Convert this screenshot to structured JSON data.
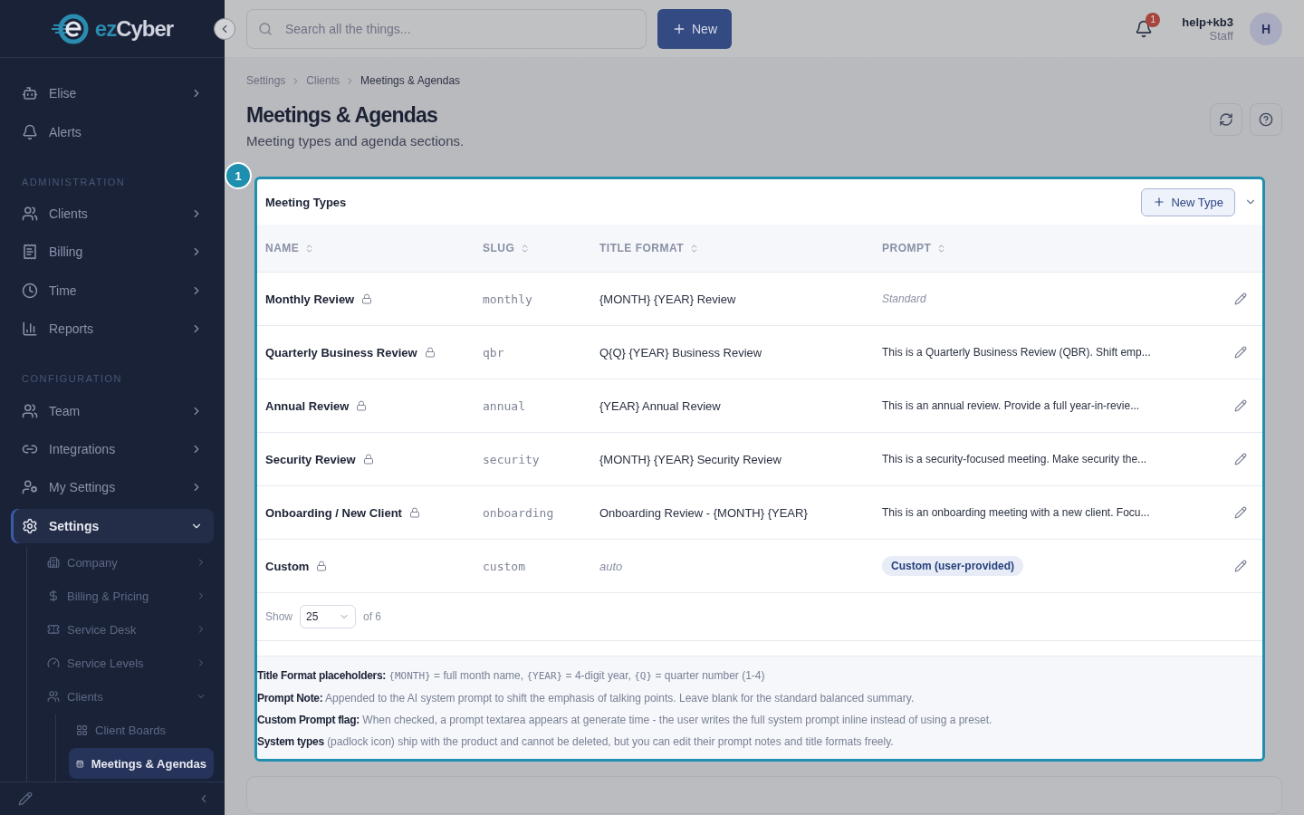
{
  "sidebar": {
    "logo": {
      "accent": "ez",
      "text": "Cyber"
    },
    "groups": [
      {
        "items": [
          {
            "label": "Elise",
            "has_chevron": true,
            "selected": false
          },
          {
            "label": "Alerts",
            "has_chevron": false,
            "selected": false
          }
        ]
      },
      {
        "heading": "ADMINISTRATION",
        "items": [
          {
            "label": "Clients",
            "has_chevron": true,
            "selected": false
          },
          {
            "label": "Billing",
            "has_chevron": true,
            "selected": false
          },
          {
            "label": "Time",
            "has_chevron": true,
            "selected": false
          },
          {
            "label": "Reports",
            "has_chevron": true,
            "selected": false
          }
        ]
      },
      {
        "heading": "CONFIGURATION",
        "items": [
          {
            "label": "Team",
            "has_chevron": true,
            "selected": false
          },
          {
            "label": "Integrations",
            "has_chevron": true,
            "selected": false
          },
          {
            "label": "My Settings",
            "has_chevron": true,
            "selected": false
          },
          {
            "label": "Settings",
            "has_chevron": true,
            "expanded": true,
            "selected": true,
            "children": [
              {
                "label": "Company",
                "selected": false
              },
              {
                "label": "Billing & Pricing",
                "selected": false
              },
              {
                "label": "Service Desk",
                "selected": false
              },
              {
                "label": "Service Levels",
                "selected": false
              },
              {
                "label": "Clients",
                "expanded": true,
                "selected": false,
                "children": [
                  {
                    "label": "Client Boards",
                    "selected": false
                  },
                  {
                    "label": "Meetings & Agendas",
                    "selected": true
                  }
                ]
              }
            ]
          }
        ]
      }
    ]
  },
  "topbar": {
    "search": {
      "placeholder": "Search all the things..."
    },
    "new_button": "New",
    "notifications": "1",
    "user": {
      "name": "help+kb3",
      "role": "Staff",
      "initial": "H"
    }
  },
  "breadcrumbs": [
    "Settings",
    "Clients",
    "Meetings & Agendas"
  ],
  "page": {
    "title": "Meetings & Agendas",
    "subtitle": "Meeting types and agenda sections."
  },
  "tour": {
    "step": "1"
  },
  "meeting_types": {
    "title": "Meeting Types",
    "new_button": "New Type",
    "columns": [
      "NAME",
      "SLUG",
      "TITLE FORMAT",
      "PROMPT"
    ],
    "rows": [
      {
        "name": "Monthly Review",
        "system": true,
        "slug": "monthly",
        "title_format": {
          "kind": "text",
          "text": "{MONTH} {YEAR} Review"
        },
        "prompt": {
          "kind": "default",
          "text": "Standard"
        }
      },
      {
        "name": "Quarterly Business Review",
        "system": true,
        "slug": "qbr",
        "title_format": {
          "kind": "text",
          "text": "Q{Q} {YEAR} Business Review"
        },
        "prompt": {
          "kind": "text",
          "text": "This is a Quarterly Business Review (QBR). Shift emp..."
        }
      },
      {
        "name": "Annual Review",
        "system": true,
        "slug": "annual",
        "title_format": {
          "kind": "text",
          "text": "{YEAR} Annual Review"
        },
        "prompt": {
          "kind": "text",
          "text": "This is an annual review. Provide a full year-in-revie..."
        }
      },
      {
        "name": "Security Review",
        "system": true,
        "slug": "security",
        "title_format": {
          "kind": "text",
          "text": "{MONTH} {YEAR} Security Review"
        },
        "prompt": {
          "kind": "text",
          "text": "This is a security-focused meeting. Make security the..."
        }
      },
      {
        "name": "Onboarding / New Client",
        "system": true,
        "slug": "onboarding",
        "title_format": {
          "kind": "text",
          "text": "Onboarding Review - {MONTH} {YEAR}"
        },
        "prompt": {
          "kind": "text",
          "text": "This is an onboarding meeting with a new client. Focu..."
        }
      },
      {
        "name": "Custom",
        "system": true,
        "slug": "custom",
        "title_format": {
          "kind": "default",
          "text": "auto"
        },
        "prompt": {
          "kind": "badge",
          "text": "Custom (user-provided)"
        }
      }
    ],
    "footer": {
      "show_label": "Show",
      "page_size": "25",
      "total": "of 6"
    }
  },
  "notes": [
    {
      "label": "Title Format placeholders:",
      "parts": [
        {
          "kind": "code",
          "text": "{MONTH}"
        },
        {
          "kind": "plain",
          "text": " = full month name, "
        },
        {
          "kind": "code",
          "text": "{YEAR}"
        },
        {
          "kind": "plain",
          "text": " = 4-digit year, "
        },
        {
          "kind": "code",
          "text": "{Q}"
        },
        {
          "kind": "plain",
          "text": " = quarter number (1-4)"
        }
      ]
    },
    {
      "label": "Prompt Note:",
      "parts": [
        {
          "kind": "plain",
          "text": "Appended to the AI system prompt to shift the emphasis of talking points. Leave blank for the standard balanced summary."
        }
      ]
    },
    {
      "label": "Custom Prompt flag:",
      "parts": [
        {
          "kind": "plain",
          "text": "When checked, a prompt textarea appears at generate time - the user writes the full system prompt inline instead of using a preset."
        }
      ]
    },
    {
      "label": "System types",
      "parts": [
        {
          "kind": "plain",
          "text": "(padlock icon) ship with the product and cannot be deleted, but you can edit their prompt notes and title formats freely."
        }
      ]
    }
  ]
}
